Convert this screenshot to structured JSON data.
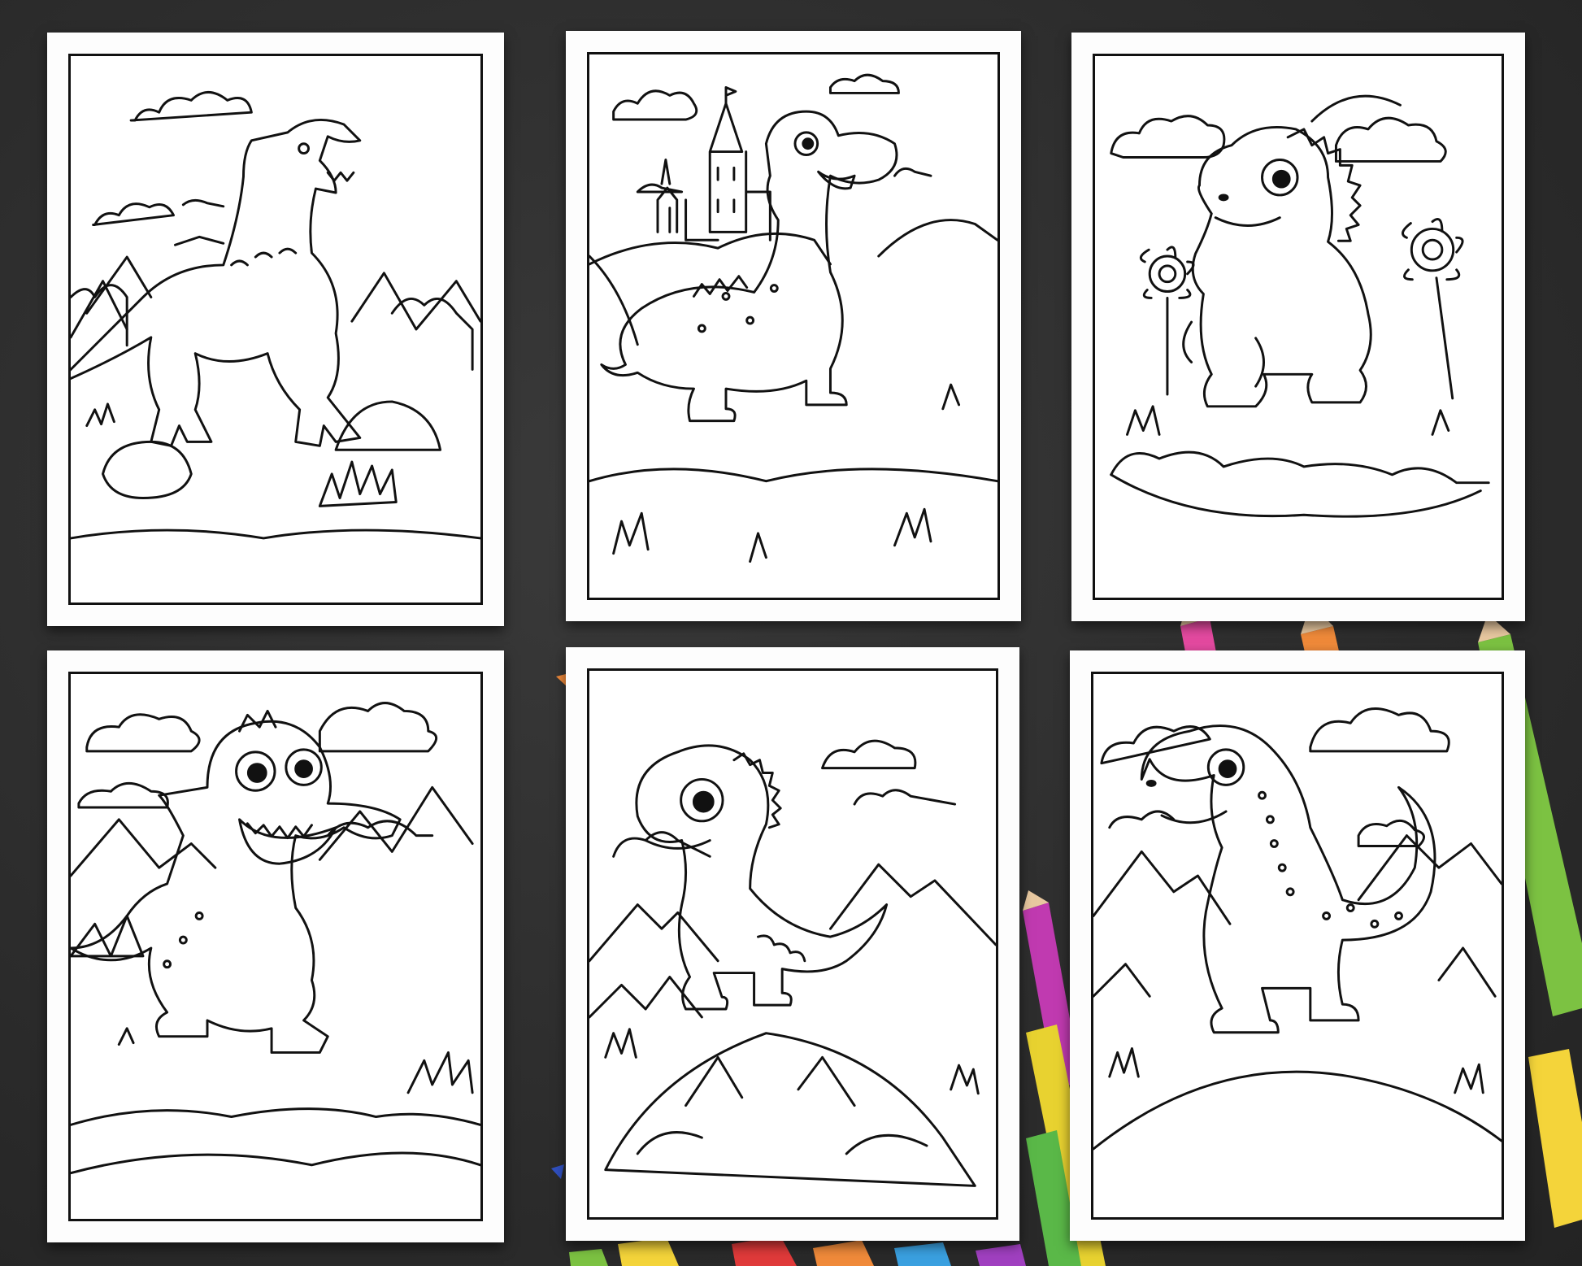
{
  "scene": {
    "background_color": "#2e2e2e",
    "page_color": "#ffffff",
    "line_color": "#111111"
  },
  "pages": [
    {
      "subject": "t-rex-roaring",
      "icon": "t-rex-icon"
    },
    {
      "subject": "dino-with-castle",
      "icon": "castle-dino-icon"
    },
    {
      "subject": "dino-with-flowers",
      "icon": "flower-dino-icon"
    },
    {
      "subject": "smiling-dino-mountains",
      "icon": "smiling-dino-icon"
    },
    {
      "subject": "dino-on-rock",
      "icon": "rock-dino-icon"
    },
    {
      "subject": "spotted-dino-hill",
      "icon": "spotted-dino-icon"
    }
  ],
  "pencils": [
    {
      "color": "#e44aa0"
    },
    {
      "color": "#f08a3a"
    },
    {
      "color": "#f4d43a"
    },
    {
      "color": "#7cc242"
    },
    {
      "color": "#3aa0e0"
    },
    {
      "color": "#a040c0"
    },
    {
      "color": "#e03a3a"
    }
  ]
}
